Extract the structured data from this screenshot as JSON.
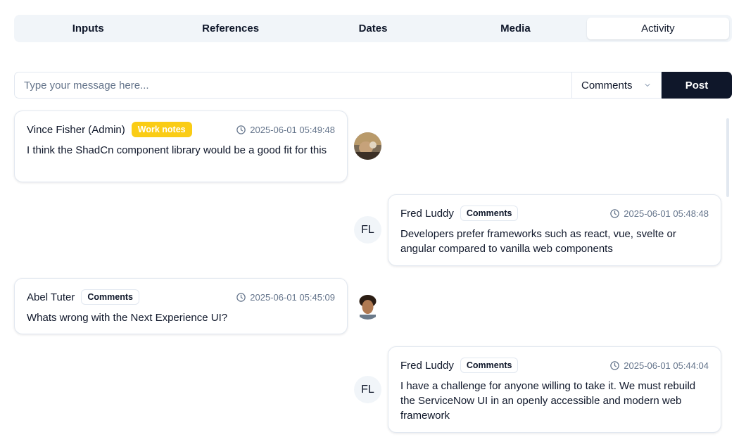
{
  "tabs": [
    {
      "label": "Inputs"
    },
    {
      "label": "References"
    },
    {
      "label": "Dates"
    },
    {
      "label": "Media"
    },
    {
      "label": "Activity",
      "active": true
    }
  ],
  "composer": {
    "placeholder": "Type your message here...",
    "selected_type": "Comments",
    "post_label": "Post"
  },
  "feed": [
    {
      "author": "Vince Fisher (Admin)",
      "badge": "Work notes",
      "timestamp": "2025-06-01 05:49:48",
      "body": "I think the ShadCn component library would be a good fit for this",
      "avatar": "photo"
    },
    {
      "author": "Fred Luddy",
      "badge": "Comments",
      "timestamp": "2025-06-01 05:48:48",
      "body": "Developers prefer frameworks such as react, vue, svelte or angular compared to vanilla web components",
      "avatar_initials": "FL"
    },
    {
      "author": "Abel Tuter",
      "badge": "Comments",
      "timestamp": "2025-06-01 05:45:09",
      "body": "Whats wrong with the Next Experience UI?",
      "avatar": "photo"
    },
    {
      "author": "Fred Luddy",
      "badge": "Comments",
      "timestamp": "2025-06-01 05:44:04",
      "body": "I have a challenge for anyone willing to take it. We must rebuild the ServiceNow UI in an openly accessible and modern web framework",
      "avatar_initials": "FL"
    }
  ],
  "colors": {
    "primary": "#0f172a",
    "work_notes_badge": "#facc15",
    "muted_text": "#64748b",
    "border": "#e2e8f0",
    "tab_bg": "#f1f5f9"
  },
  "icons": {
    "timestamp": "clock-icon",
    "select": "chevron-down-icon"
  }
}
